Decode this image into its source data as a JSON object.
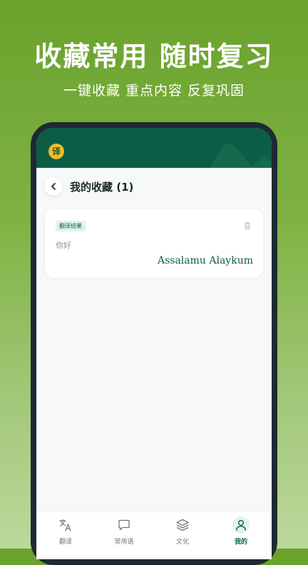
{
  "promo": {
    "headline": "收藏常用 随时复习",
    "subline": "一键收藏 重点内容 反复巩固"
  },
  "app": {
    "logo_char": "译",
    "brand_color": "#0b5e45",
    "accent_color": "#f4b827"
  },
  "header": {
    "title": "我的收藏 (1)",
    "back_icon": "chevron-left-icon"
  },
  "favorites": [
    {
      "tag": "翻译结果",
      "source": "你好",
      "target": "Assalamu Alaykum",
      "delete_icon": "trash-icon"
    }
  ],
  "tabs": [
    {
      "label": "翻译",
      "icon": "translate-icon"
    },
    {
      "label": "常用语",
      "icon": "chat-bubble-icon"
    },
    {
      "label": "文化",
      "icon": "layers-icon"
    },
    {
      "label": "我的",
      "icon": "user-icon",
      "active": true
    }
  ]
}
